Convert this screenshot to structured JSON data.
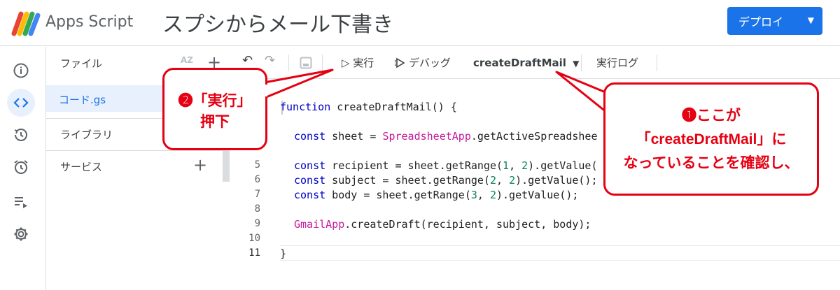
{
  "header": {
    "app_name": "Apps Script",
    "project_title": "スプシからメール下書き",
    "deploy_label": "デプロイ",
    "deploy_caret": "▼"
  },
  "rail": {
    "icons": [
      "info-icon",
      "code-icon",
      "history-icon",
      "alarm-icon",
      "executions-icon",
      "gear-icon"
    ],
    "active_index": 1
  },
  "files": {
    "title": "ファイル",
    "sort_label": "AZ",
    "add_symbol": "+",
    "file_name": "コード.gs",
    "libraries_label": "ライブラリ",
    "services_label": "サービス"
  },
  "toolbar": {
    "undo": "↶",
    "redo": "↷",
    "run_label": "▷ 実行",
    "debug_label": "デバッグ",
    "function_name": "createDraftMail",
    "function_caret": "▼",
    "log_label": "実行ログ"
  },
  "editor": {
    "line_numbers": [
      "5",
      "6",
      "7",
      "8",
      "9",
      "10",
      "11"
    ],
    "lines": [
      {
        "kw": "function",
        "rest": " createDraftMail() {"
      },
      {
        "kw": "const",
        "rest": " sheet = ",
        "cls": "SpreadsheetApp",
        "tail": ".getActiveSpreadshee"
      },
      {
        "kw": "const",
        "rest": " recipient = sheet.getRange(",
        "n1": "1",
        "mid": ", ",
        "n2": "2",
        "tail": ").getValue("
      },
      {
        "kw": "const",
        "rest": " subject = sheet.getRange(",
        "n1": "2",
        "mid": ", ",
        "n2": "2",
        "tail": ").getValue();"
      },
      {
        "kw": "const",
        "rest": " body = sheet.getRange(",
        "n1": "3",
        "mid": ", ",
        "n2": "2",
        "tail": ").getValue();"
      },
      {
        "cls": "GmailApp",
        "tail": ".createDraft(recipient, subject, body);"
      },
      {
        "rest": "}"
      }
    ]
  },
  "callouts": {
    "run": {
      "line1": "❷「実行」",
      "line2": "押下"
    },
    "check": {
      "line1": "❶ここが",
      "line2": "「createDraftMail」に",
      "line3": "なっていることを確認し、"
    }
  },
  "colors": {
    "accent": "#1a73e8",
    "callout_red": "#e50012"
  }
}
